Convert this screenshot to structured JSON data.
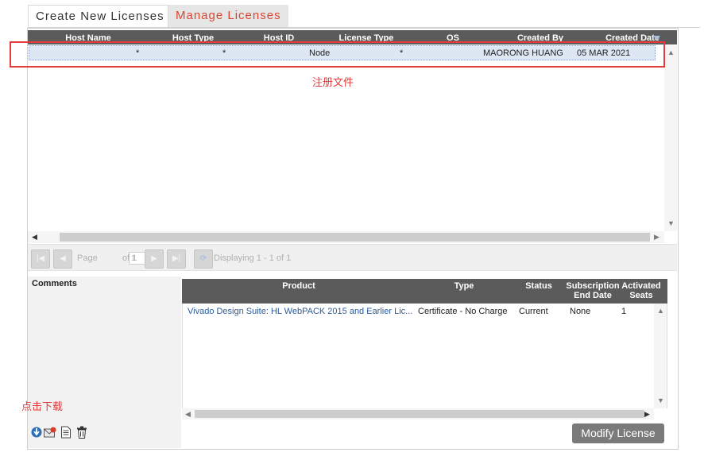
{
  "tabs": [
    {
      "label": "Create New Licenses"
    },
    {
      "label": "Manage Licenses"
    }
  ],
  "grid": {
    "columns": [
      "Host Name",
      "Host Type",
      "Host ID",
      "License Type",
      "OS",
      "Created By",
      "Created Date"
    ],
    "rows": [
      {
        "host_name": "*",
        "host_type": "*",
        "host_id": "",
        "license_type": "Node",
        "os": "*",
        "created_by": "MAORONG HUANG",
        "created_date": "05 MAR 2021"
      }
    ]
  },
  "annotations": {
    "register_file": "注册文件",
    "click_download": "点击下载"
  },
  "pager": {
    "page_label": "Page",
    "page_value": "1",
    "of_label": "of 1",
    "displaying": "Displaying 1 - 1 of 1"
  },
  "comments": {
    "label": "Comments"
  },
  "products": {
    "columns": [
      "Product",
      "Type",
      "Status",
      "Subscription End Date",
      "Activated Seats"
    ],
    "rows": [
      {
        "product": "Vivado Design Suite: HL WebPACK 2015 and Earlier Lic...",
        "type": "Certificate - No Charge",
        "status": "Current",
        "end_date": "None",
        "seats": "1"
      }
    ]
  },
  "buttons": {
    "modify": "Modify License"
  },
  "colors": {
    "accent_red": "#e23c3c",
    "header_gray": "#5b5b5b",
    "selected_row": "#dde6f3",
    "link_blue": "#2a5d9c"
  },
  "icons": [
    "download-icon",
    "email-icon",
    "document-icon",
    "trash-icon",
    "refresh-icon"
  ]
}
